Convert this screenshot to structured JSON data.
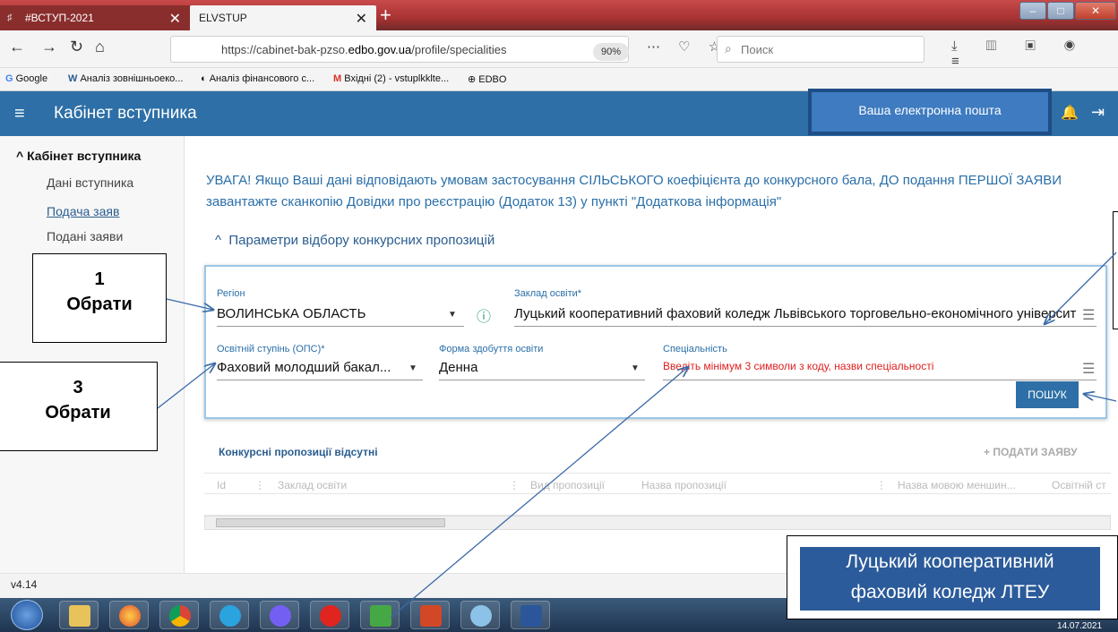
{
  "browser": {
    "tab1_title": "#ВСТУП-2021",
    "tab2_title": "ELVSTUP",
    "url_prefix": "https://cabinet-bak-pzso.",
    "url_domain": "edbo.gov.ua",
    "url_path": "/profile/specialities",
    "zoom": "90%",
    "search_placeholder": "Поиск",
    "bookmarks": [
      "Google",
      "Аналіз зовнішньоеко...",
      "Аналіз фінансового с...",
      "Вхідні (2) - vstuplkklte...",
      "EDBO"
    ]
  },
  "header": {
    "title": "Кабінет вступника",
    "email_label": "Ваша електронна пошта"
  },
  "sidebar": {
    "heading": "Кабінет вступника",
    "items": [
      "Дані вступника",
      "Подача заяв",
      "Подані заяви"
    ]
  },
  "main": {
    "notice": "УВАГА! Якщо Ваші дані відповідають умовам застосування СІЛЬСЬКОГО коефіцієнта до конкурсного бала, ДО подання ПЕРШОЇ ЗАЯВИ завантажте сканкопію Довідки про реєстрацію (Додаток 13) у пункті \"Додаткова інформація\"",
    "params_toggle": "Параметри відбору конкурсних пропозицій",
    "form": {
      "region_label": "Регіон",
      "region_value": "ВОЛИНСЬКА ОБЛАСТЬ",
      "institution_label": "Заклад освіти*",
      "institution_value": "Луцький кооперативний фаховий коледж Львівського торговельно-економічного університету",
      "degree_label": "Освітній ступінь (ОПС)*",
      "degree_value": "Фаховий молодший бакал...",
      "study_form_label": "Форма здобуття освіти",
      "study_form_value": "Денна",
      "specialty_label": "Спеціальність",
      "specialty_placeholder": "Введіть мінімум 3 символи з коду, назви спеціальності",
      "search_button": "ПОШУК"
    },
    "table": {
      "title": "Конкурсні пропозиції відсутні",
      "add_button": "ПОДАТИ ЗАЯВУ",
      "columns": [
        "Id",
        "Заклад освіти",
        "Вид пропозиції",
        "Назва пропозиції",
        "Назва мовою меншин...",
        "Освітній ст"
      ]
    },
    "version": "v4.14"
  },
  "annotations": {
    "box1_num": "1",
    "box1_text": "Обрати",
    "box3_num": "3",
    "box3_text": "Обрати",
    "college_line1": "Луцький кооперативний",
    "college_line2": "фаховий коледж ЛТЕУ"
  },
  "taskbar": {
    "date": "14.07.2021"
  },
  "colors": {
    "header_blue": "#2d6fa6",
    "accent_link": "#2a6fa8",
    "error_red": "#e02020"
  }
}
